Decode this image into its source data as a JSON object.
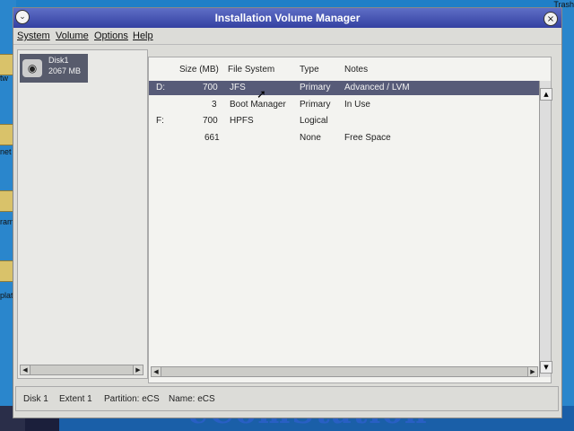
{
  "window": {
    "title": "Installation Volume Manager"
  },
  "menu": [
    {
      "label": "System"
    },
    {
      "label": "Volume"
    },
    {
      "label": "Options"
    },
    {
      "label": "Help"
    }
  ],
  "disk": {
    "name": "Disk1",
    "size": "2067 MB"
  },
  "table": {
    "headers": {
      "size": "Size (MB)",
      "fs": "File System",
      "type": "Type",
      "notes": "Notes"
    },
    "rows": [
      {
        "drive": "D:",
        "size": "700",
        "fs": "JFS",
        "type": "Primary",
        "notes": "Advanced / LVM"
      },
      {
        "drive": "",
        "size": "3",
        "fs": "Boot Manager",
        "type": "Primary",
        "notes": "In Use"
      },
      {
        "drive": "F:",
        "size": "700",
        "fs": "HPFS",
        "type": "Logical",
        "notes": ""
      },
      {
        "drive": "",
        "size": "661",
        "fs": "",
        "type": "None",
        "notes": "Free Space"
      }
    ]
  },
  "status": {
    "disk": "Disk 1",
    "extent": "Extent 1",
    "partition": "Partition: eCS",
    "name": "Name: eCS"
  },
  "desktop": {
    "trash": "Trash",
    "icon_labels": [
      "tw",
      "net",
      "ram",
      "plate"
    ],
    "brand": "eComStation"
  },
  "colors": {
    "titlebar": "#3f4cab",
    "selection": "#575b78",
    "desktop": "#1f7fc7"
  }
}
